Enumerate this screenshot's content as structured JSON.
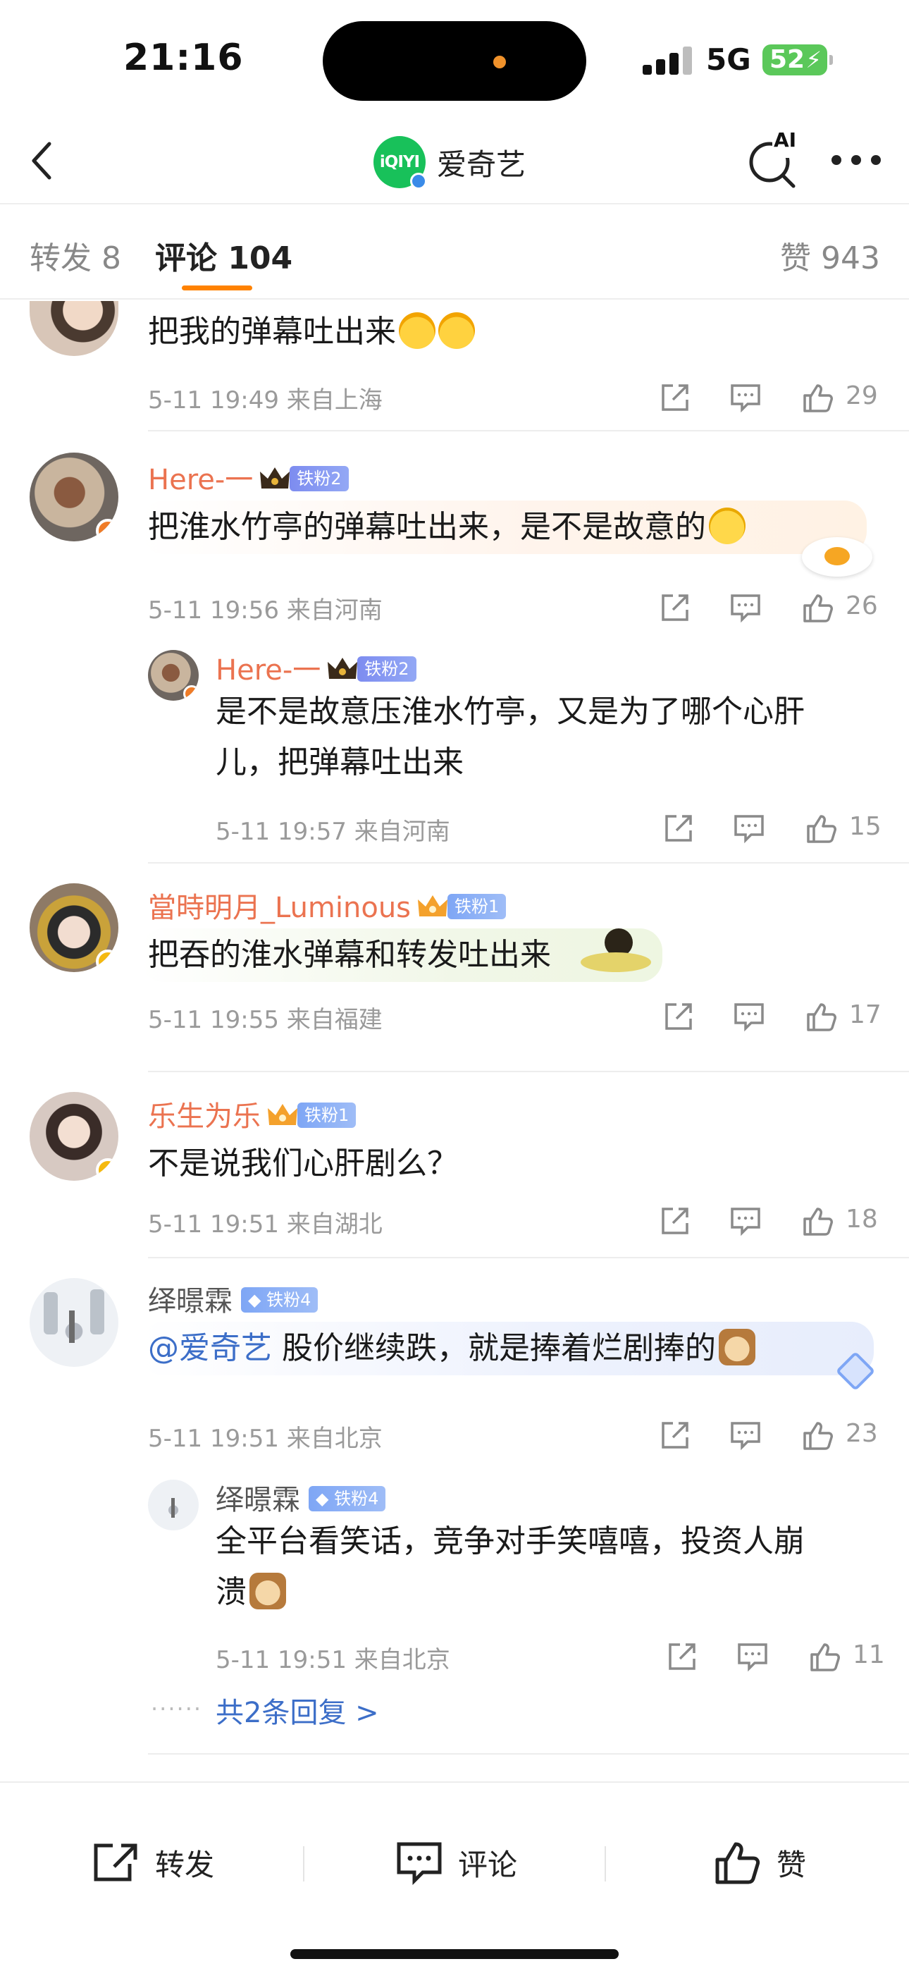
{
  "status_bar": {
    "time": "21:16",
    "network": "5G",
    "battery": "52"
  },
  "nav": {
    "brand_logo": "iQIYI",
    "brand_name": "爱奇艺",
    "ai_label": "AI"
  },
  "tabs": {
    "repost": "转发 8",
    "comments": "评论 104",
    "likes": "赞 943"
  },
  "comments": [
    {
      "text": "把我的弹幕吐出来",
      "time": "5-11 19:49",
      "location": "来自上海",
      "likes": "29"
    },
    {
      "name": "Here-一",
      "badge": "铁粉2",
      "text": "把淮水竹亭的弹幕吐出来，是不是故意的",
      "time": "5-11 19:56",
      "location": "来自河南",
      "likes": "26",
      "reply": {
        "name": "Here-一",
        "badge": "铁粉2",
        "text_line1": "是不是故意压淮水竹亭，又是为了哪个心肝",
        "text_line2": "儿，把弹幕吐出来",
        "time": "5-11 19:57",
        "location": "来自河南",
        "likes": "15"
      }
    },
    {
      "name": "當時明月_Luminous",
      "badge": "铁粉1",
      "text": "把吞的淮水弹幕和转发吐出来",
      "time": "5-11 19:55",
      "location": "来自福建",
      "likes": "17"
    },
    {
      "name": "乐生为乐",
      "badge": "铁粉1",
      "text": "不是说我们心肝剧么？",
      "time": "5-11 19:51",
      "location": "来自湖北",
      "likes": "18"
    },
    {
      "name": "绎暻霖",
      "badge": "铁粉4",
      "mention": "@爱奇艺",
      "text": " 股价继续跌，就是捧着烂剧捧的",
      "time": "5-11 19:51",
      "location": "来自北京",
      "likes": "23",
      "reply": {
        "name": "绎暻霖",
        "badge": "铁粉4",
        "text_line1": "全平台看笑话，竞争对手笑嘻嘻，投资人崩",
        "text_line2": "溃",
        "time": "5-11 19:51",
        "location": "来自北京",
        "likes": "11"
      },
      "more_replies": "共2条回复 >"
    }
  ],
  "bottom_bar": {
    "repost": "转发",
    "comment": "评论",
    "like": "赞"
  },
  "colors": {
    "accent": "#ff8200",
    "username": "#eb7350",
    "link": "#3c6ec8",
    "verified_yellow": "#f5b90f",
    "verified_orange": "#f07c27"
  }
}
